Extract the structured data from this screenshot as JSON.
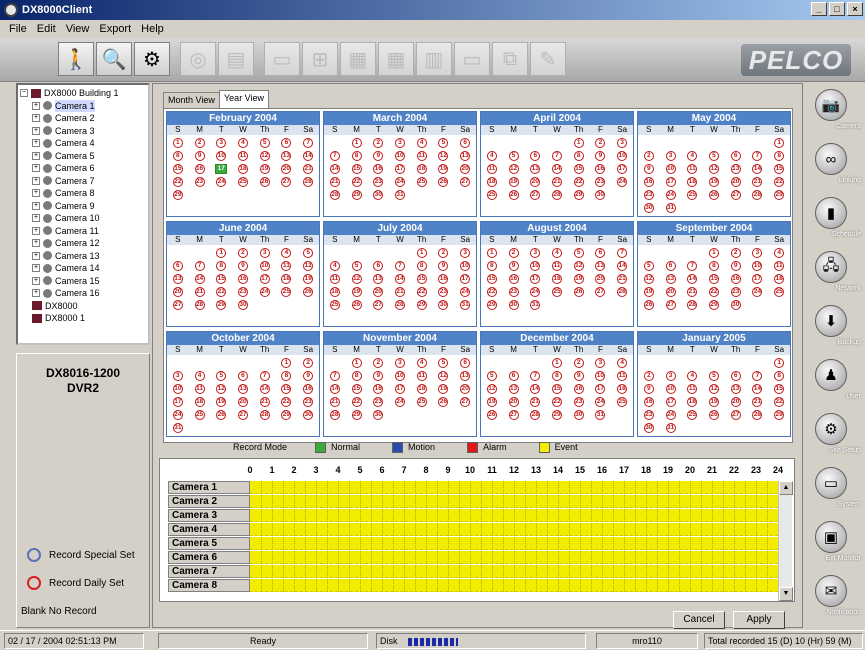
{
  "window": {
    "title": "DX8000Client"
  },
  "menu": [
    "File",
    "Edit",
    "View",
    "Export",
    "Help"
  ],
  "brand": {
    "logo": "PELCO"
  },
  "tree": {
    "root": "DX8000 Building 1",
    "cameras": [
      "Camera 1",
      "Camera 2",
      "Camera 3",
      "Camera 4",
      "Camera 5",
      "Camera 6",
      "Camera 7",
      "Camera 8",
      "Camera 9",
      "Camera 10",
      "Camera 11",
      "Camera 12",
      "Camera 13",
      "Camera 14",
      "Camera 15",
      "Camera 16"
    ],
    "extra": [
      "DX8000",
      "DX8000 1"
    ]
  },
  "dvr": {
    "line1": "DX8016-1200",
    "line2": "DVR2"
  },
  "legend": {
    "special": "Record Special Set",
    "daily": "Record Daily Set",
    "blank": "Blank No Record"
  },
  "tabs": {
    "month": "Month View",
    "year": "Year View"
  },
  "weekdays": [
    "S",
    "M",
    "T",
    "W",
    "Th",
    "F",
    "Sa"
  ],
  "months": [
    {
      "name": "February 2004",
      "start": 0,
      "days": 29,
      "today": 17
    },
    {
      "name": "March 2004",
      "start": 1,
      "days": 31
    },
    {
      "name": "April 2004",
      "start": 4,
      "days": 30
    },
    {
      "name": "May 2004",
      "start": 6,
      "days": 31
    },
    {
      "name": "June 2004",
      "start": 2,
      "days": 30
    },
    {
      "name": "July 2004",
      "start": 4,
      "days": 31
    },
    {
      "name": "August 2004",
      "start": 0,
      "days": 31
    },
    {
      "name": "September 2004",
      "start": 3,
      "days": 30
    },
    {
      "name": "October 2004",
      "start": 5,
      "days": 31
    },
    {
      "name": "November 2004",
      "start": 1,
      "days": 30
    },
    {
      "name": "December 2004",
      "start": 3,
      "days": 31
    },
    {
      "name": "January 2005",
      "start": 6,
      "days": 31
    }
  ],
  "record_mode": {
    "label": "Record Mode",
    "items": [
      {
        "label": "Normal",
        "color": "#3aaa3a"
      },
      {
        "label": "Motion",
        "color": "#2a4ab0"
      },
      {
        "label": "Alarm",
        "color": "#e01818"
      },
      {
        "label": "Event",
        "color": "#f2ec00"
      }
    ]
  },
  "schedule": {
    "hours": [
      "0",
      "1",
      "2",
      "3",
      "4",
      "5",
      "6",
      "7",
      "8",
      "9",
      "10",
      "11",
      "12",
      "13",
      "14",
      "15",
      "16",
      "17",
      "18",
      "19",
      "20",
      "21",
      "22",
      "23",
      "24"
    ],
    "cameras": [
      "Camera 1",
      "Camera 2",
      "Camera 3",
      "Camera 4",
      "Camera 5",
      "Camera 6",
      "Camera 7",
      "Camera 8"
    ],
    "fill_color": "#f2ec00"
  },
  "buttons": {
    "cancel": "Cancel",
    "apply": "Apply"
  },
  "sidebar": [
    {
      "label": "Camera",
      "icon": "camera-icon"
    },
    {
      "label": "Linking",
      "icon": "linking-icon"
    },
    {
      "label": "Schedule",
      "icon": "schedule-icon"
    },
    {
      "label": "Network",
      "icon": "network-icon"
    },
    {
      "label": "Backup",
      "icon": "backup-icon"
    },
    {
      "label": "User",
      "icon": "user-icon"
    },
    {
      "label": "Site Setup",
      "icon": "site-setup-icon"
    },
    {
      "label": "System",
      "icon": "system-icon"
    },
    {
      "label": "Ext Monitor",
      "icon": "ext-monitor-icon"
    },
    {
      "label": "Notification",
      "icon": "notification-icon"
    }
  ],
  "status": {
    "datetime": "02 / 17 / 2004  02:51:13 PM",
    "state": "Ready",
    "disk_label": "Disk",
    "user": "mro110",
    "total": "Total recorded 15 (D) 10 (Hr) 59 (M)"
  }
}
